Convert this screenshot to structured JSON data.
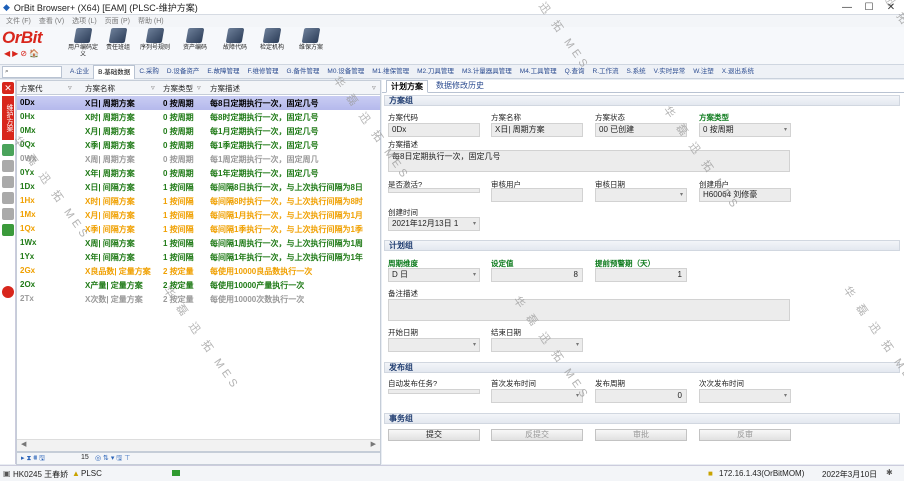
{
  "window": {
    "title": "OrBit Browser+ (X64) [EAM] (PLSC-维护方案)",
    "min": "—",
    "max": "☐",
    "close": "✕"
  },
  "menu": [
    "文件 (F)",
    "查看 (V)",
    "选项 (L)",
    "页面 (P)",
    "帮助 (H)"
  ],
  "logo": "OrBit",
  "toolbar": [
    "用户编码定义",
    "责任班组",
    "序列号规则",
    "资产编码",
    "故障代码",
    "检定机构",
    "维保方案"
  ],
  "tabs": [
    "A.企业",
    "B.基础数据",
    "C.采购",
    "D.设备资产",
    "E.故障管理",
    "F.维修管理",
    "G.备件管理",
    "M0.设备管理",
    "M1.维保管理",
    "M2.刀具管理",
    "M3.计量器具管理",
    "M4.工具管理",
    "Q.查询",
    "R.工作流",
    "S.系统",
    "V.实时异常",
    "W.注塑",
    "X.退出系统"
  ],
  "side": {
    "label": "维护方案"
  },
  "grid": {
    "headers": [
      "方案代",
      "方案名称",
      "方案类型",
      "方案描述"
    ],
    "rows": [
      {
        "code": "0Dx",
        "name": "X日| 周期方案",
        "type": "0 按周期",
        "desc": "每8日定期执行一次，固定几号",
        "color": "#000000"
      },
      {
        "code": "0Hx",
        "name": "X时| 周期方案",
        "type": "0 按周期",
        "desc": "每8时定期执行一次，固定几号",
        "color": "#1f7a16"
      },
      {
        "code": "0Mx",
        "name": "X月| 周期方案",
        "type": "0 按周期",
        "desc": "每1月定期执行一次，固定几号",
        "color": "#1f7a16"
      },
      {
        "code": "0Qx",
        "name": "X季| 周期方案",
        "type": "0 按周期",
        "desc": "每1季定期执行一次，固定几号",
        "color": "#1f7a16"
      },
      {
        "code": "0Wx",
        "name": "X周| 周期方案",
        "type": "0 按周期",
        "desc": "每1周定期执行一次，固定周几",
        "color": "#9a9a9a"
      },
      {
        "code": "0Yx",
        "name": "X年| 周期方案",
        "type": "0 按周期",
        "desc": "每1年定期执行一次，固定几号",
        "color": "#1f7a16"
      },
      {
        "code": "1Dx",
        "name": "X日| 间隔方案",
        "type": "1 按间隔",
        "desc": "每间隔8日执行一次，与上次执行间隔为8日",
        "color": "#1f7a16"
      },
      {
        "code": "1Hx",
        "name": "X时| 间隔方案",
        "type": "1 按间隔",
        "desc": "每间隔8时执行一次，与上次执行间隔为8时",
        "color": "#f0a000"
      },
      {
        "code": "1Mx",
        "name": "X月| 间隔方案",
        "type": "1 按间隔",
        "desc": "每间隔1月执行一次，与上次执行间隔为1月",
        "color": "#f0a000"
      },
      {
        "code": "1Qx",
        "name": "X季| 间隔方案",
        "type": "1 按间隔",
        "desc": "每间隔1季执行一次，与上次执行间隔为1季",
        "color": "#f0a000"
      },
      {
        "code": "1Wx",
        "name": "X周| 间隔方案",
        "type": "1 按间隔",
        "desc": "每间隔1周执行一次，与上次执行间隔为1周",
        "color": "#1f7a16"
      },
      {
        "code": "1Yx",
        "name": "X年| 间隔方案",
        "type": "1 按间隔",
        "desc": "每间隔1年执行一次，与上次执行间隔为1年",
        "color": "#1f7a16"
      },
      {
        "code": "2Gx",
        "name": "X良品数| 定量方案",
        "type": "2 按定量",
        "desc": "每使用10000良品数执行一次",
        "color": "#f0a000"
      },
      {
        "code": "2Ox",
        "name": "X产量| 定量方案",
        "type": "2 按定量",
        "desc": "每使用10000产量执行一次",
        "color": "#1f7a16"
      },
      {
        "code": "2Tx",
        "name": "X次数| 定量方案",
        "type": "2 按定量",
        "desc": "每使用10000次数执行一次",
        "color": "#9a9a9a"
      }
    ],
    "footer_count": "15"
  },
  "form": {
    "tabs": [
      "计划方案",
      "数据修改历史"
    ],
    "sections": {
      "scheme": "方案组",
      "plan": "计划组",
      "publish": "发布组",
      "transaction": "事务组"
    },
    "labels": {
      "code": "方案代码",
      "name": "方案名称",
      "status": "方案状态",
      "type": "方案类型",
      "desc": "方案描述",
      "active": "是否激活?",
      "reviewer": "审核用户",
      "review_date": "审核日期",
      "creator": "创建用户",
      "create_time": "创建时间",
      "cycle": "周期维度",
      "set_value": "设定值",
      "warn": "提前预警期（天）",
      "remark": "备注描述",
      "start": "开始日期",
      "end": "结束日期",
      "auto_pub": "自动发布任务?",
      "first_pub": "首次发布时间",
      "pub_cycle": "发布周期",
      "next_pub": "次次发布时间"
    },
    "values": {
      "code": "0Dx",
      "name": "X日| 周期方案",
      "status": "00 已创建",
      "type": "0 按周期",
      "desc": "每8日定期执行一次，固定几号",
      "creator": "H60064 刘修豪",
      "create_time": "2021年12月13日 1",
      "cycle": "D 日",
      "set_value": "8",
      "warn": "1",
      "pub_cycle": "0"
    },
    "buttons": [
      "提交",
      "反提交",
      "审批",
      "反审"
    ]
  },
  "status": {
    "user": "HK0245 王春娇",
    "app": "PLSC",
    "server": "172.16.1.43(OrBitMOM)",
    "date": "2022年3月10日"
  },
  "watermark": "华 磊 迅 拓  MES"
}
